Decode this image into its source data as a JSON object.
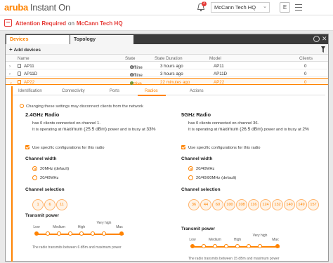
{
  "app": {
    "brand": "aruba",
    "product": "Instant On"
  },
  "header": {
    "site_name": "McCann Tech HQ",
    "avatar_letter": "E",
    "notification_count": "2"
  },
  "alert": {
    "text": "Attention Required",
    "connector": "on",
    "site": "McCann Tech HQ"
  },
  "tabs": [
    {
      "label": "Devices"
    },
    {
      "label": "Topology"
    }
  ],
  "toolbar": {
    "add_devices": "Add devices"
  },
  "table": {
    "headers": [
      "Name",
      "State",
      "State Duration",
      "Model",
      "Clients"
    ],
    "rows": [
      {
        "name": "AP11",
        "state": "Offline",
        "duration": "3 hours ago",
        "model": "AP11",
        "clients": "0",
        "state_color": "#9e9e9e"
      },
      {
        "name": "AP11D",
        "state": "Offline",
        "duration": "3 hours ago",
        "model": "AP11D",
        "clients": "0",
        "state_color": "#9e9e9e"
      },
      {
        "name": "AP22",
        "state": "Active",
        "duration": "22 minutes ago",
        "model": "AP22",
        "clients": "0",
        "state_color": "#43a047"
      }
    ]
  },
  "subtabs": [
    "Identification",
    "Connectivity",
    "Ports",
    "Radios",
    "Actions"
  ],
  "radios": {
    "note": "Changing these settings may disconnect clients from the network",
    "r24": {
      "title": "2.4GHz Radio",
      "line1_pre": "has 0 clients connected on channel 1.",
      "line2_pre": "It is operating at",
      "line2_max": "maximum (25.5 dBm)",
      "line2_post": "power and is busy at",
      "line2_busy": "33%",
      "specific": "Use specific configurations for this radio",
      "width_title": "Channel width",
      "width_opts": [
        "20MHz (default)",
        "20/40MHz"
      ],
      "chan_title": "Channel selection",
      "channels": [
        "1",
        "6",
        "11"
      ],
      "power_title": "Transmit power",
      "power_labels": [
        "Low",
        "Medium",
        "High",
        "Very high",
        "Max"
      ],
      "power_note": "The radio transmits between 6 dBm and maximum power"
    },
    "r5": {
      "title": "5GHz Radio",
      "line1_pre": "has 0 clients connected on channel 36.",
      "line2_pre": "It is operating at",
      "line2_max": "maximum (26.5 dBm)",
      "line2_post": "power and is busy at",
      "line2_busy": "2%",
      "specific": "Use specific configurations for this radio",
      "width_title": "Channel width",
      "width_opts": [
        "20/40MHz",
        "20/40/80MHz (default)"
      ],
      "chan_title": "Channel selection",
      "channels": [
        "36",
        "44",
        "60",
        "100",
        "108",
        "116",
        "124",
        "132",
        "140",
        "149",
        "157"
      ],
      "power_title": "Transmit power",
      "power_labels": [
        "Low",
        "Medium",
        "High",
        "Very high",
        "Max"
      ],
      "power_note": "The radio transmits between 15 dBm and maximum power"
    }
  },
  "colors": {
    "accent": "#ff8300",
    "alert": "#e53935"
  }
}
